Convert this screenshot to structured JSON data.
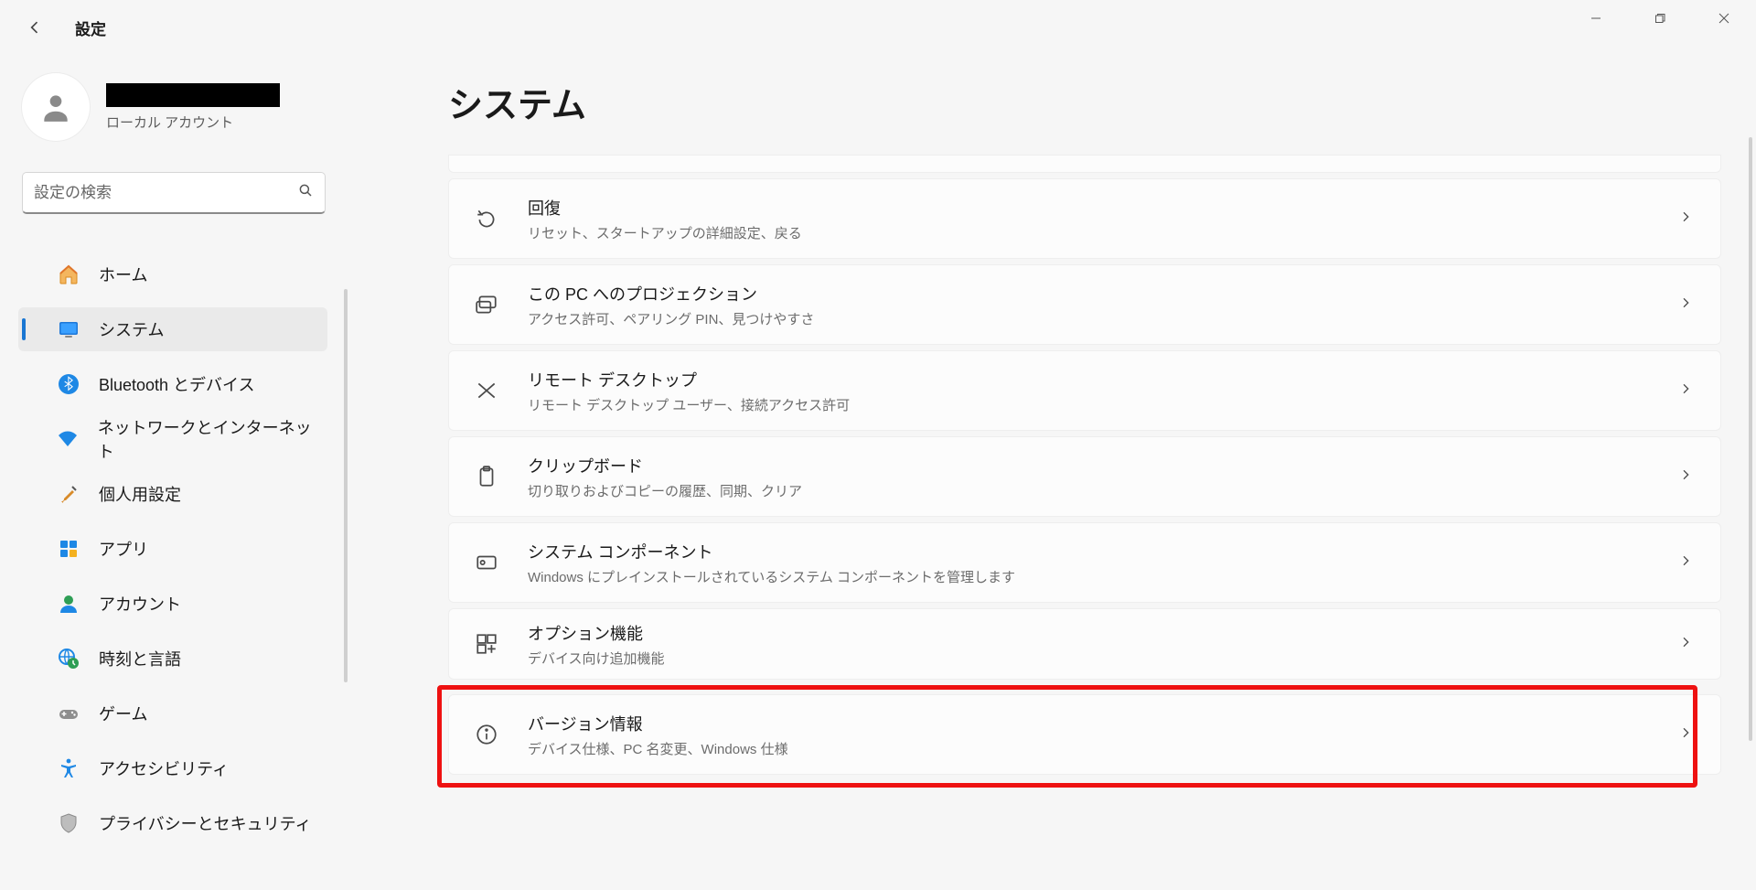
{
  "titlebar": {
    "app_title": "設定"
  },
  "account": {
    "subtitle": "ローカル アカウント"
  },
  "search": {
    "placeholder": "設定の検索"
  },
  "sidebar": {
    "items": [
      {
        "label": "ホーム"
      },
      {
        "label": "システム"
      },
      {
        "label": "Bluetooth とデバイス"
      },
      {
        "label": "ネットワークとインターネット"
      },
      {
        "label": "個人用設定"
      },
      {
        "label": "アプリ"
      },
      {
        "label": "アカウント"
      },
      {
        "label": "時刻と言語"
      },
      {
        "label": "ゲーム"
      },
      {
        "label": "アクセシビリティ"
      },
      {
        "label": "プライバシーとセキュリティ"
      }
    ],
    "selected_index": 1
  },
  "page": {
    "title": "システム",
    "items": [
      {
        "title": "回復",
        "sub": "リセット、スタートアップの詳細設定、戻る"
      },
      {
        "title": "この PC へのプロジェクション",
        "sub": "アクセス許可、ペアリング PIN、見つけやすさ"
      },
      {
        "title": "リモート デスクトップ",
        "sub": "リモート デスクトップ ユーザー、接続アクセス許可"
      },
      {
        "title": "クリップボード",
        "sub": "切り取りおよびコピーの履歴、同期、クリア"
      },
      {
        "title": "システム コンポーネント",
        "sub": "Windows にプレインストールされているシステム コンポーネントを管理します"
      },
      {
        "title": "オプション機能",
        "sub": "デバイス向け追加機能"
      },
      {
        "title": "バージョン情報",
        "sub": "デバイス仕様、PC 名変更、Windows 仕様"
      }
    ],
    "highlighted_index": 6
  }
}
